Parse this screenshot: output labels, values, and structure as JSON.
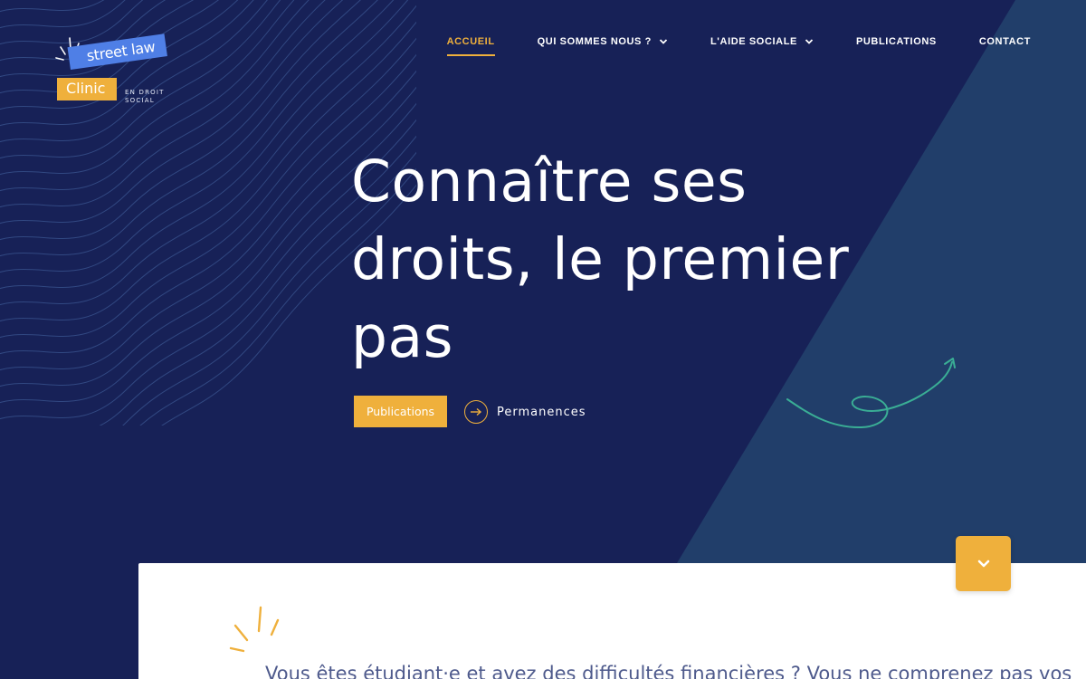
{
  "logo": {
    "line1": "street law",
    "line2": "Clinic",
    "sub_line1": "EN DROIT",
    "sub_line2": "SOCIAL"
  },
  "nav": {
    "items": [
      {
        "label": "ACCUEIL",
        "active": true,
        "has_dropdown": false
      },
      {
        "label": "QUI SOMMES NOUS ?",
        "active": false,
        "has_dropdown": true
      },
      {
        "label": "L'AIDE SOCIALE",
        "active": false,
        "has_dropdown": true
      },
      {
        "label": "PUBLICATIONS",
        "active": false,
        "has_dropdown": false
      },
      {
        "label": "CONTACT",
        "active": false,
        "has_dropdown": false
      }
    ]
  },
  "hero": {
    "title_line1": "Connaître ses",
    "title_line2": "droits, le premier",
    "title_line3": "pas",
    "primary_button": "Publications",
    "secondary_link": "Permanences"
  },
  "card": {
    "intro_text": "Vous êtes étudiant·e et avez des difficultés financières ? Vous ne comprenez pas vos"
  },
  "icons": {
    "scroll_down": "chevron-down-icon",
    "secondary_link": "arrow-right-circle-icon"
  },
  "colors": {
    "background": "#172157",
    "triangle": "#213e6a",
    "accent": "#efb03c",
    "logo_blue": "#4f7fe6",
    "squiggle": "#3aae95",
    "card_text": "#4e5a8c"
  }
}
